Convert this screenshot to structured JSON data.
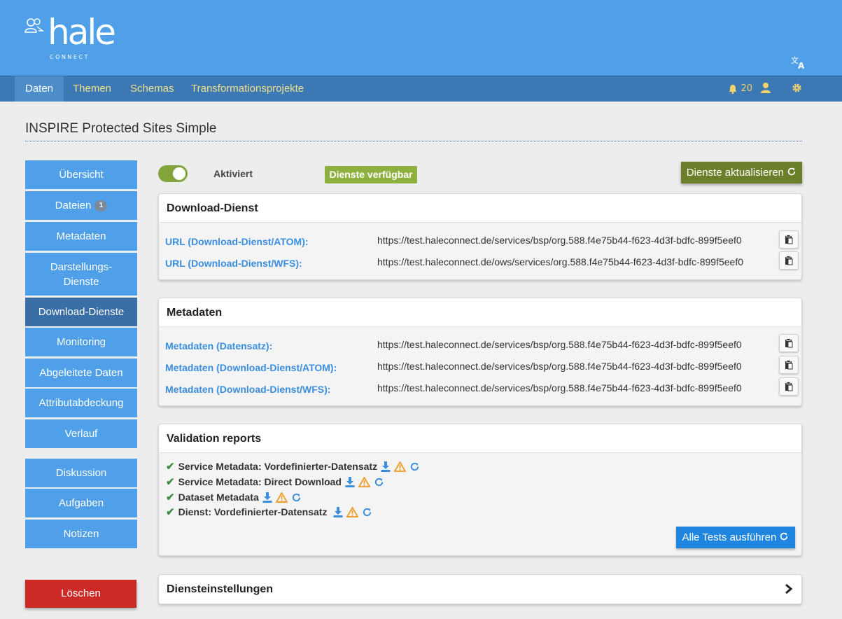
{
  "header": {
    "logo_text": "hale",
    "logo_sub": "CONNECT",
    "translate_icon": "translate-icon"
  },
  "nav": {
    "items": [
      {
        "label": "Daten",
        "active": true
      },
      {
        "label": "Themen"
      },
      {
        "label": "Schemas"
      },
      {
        "label": "Transformationsprojekte"
      }
    ],
    "notifications_count": "20",
    "icons": [
      "bell-icon",
      "user-icon",
      "gear-icon"
    ]
  },
  "page": {
    "title": "INSPIRE Protected Sites Simple"
  },
  "sidebar": {
    "items": [
      {
        "label": "Übersicht"
      },
      {
        "label": "Dateien",
        "badge": "1"
      },
      {
        "label": "Metadaten"
      },
      {
        "label": "Darstellungs-\nDienste"
      },
      {
        "label": "Download-Dienste",
        "active": true
      },
      {
        "label": "Monitoring"
      },
      {
        "label": "Abgeleitete Daten"
      },
      {
        "label": "Attributabdeckung"
      },
      {
        "label": "Verlauf"
      },
      {
        "label": "Diskussion"
      },
      {
        "label": "Aufgaben"
      },
      {
        "label": "Notizen"
      }
    ],
    "delete_label": "Löschen"
  },
  "controls": {
    "toggle_label": "Aktiviert",
    "toggle_on": true,
    "status_badge": "Dienste verfügbar",
    "refresh_label": "Dienste aktualisieren"
  },
  "download_panel": {
    "title": "Download-Dienst",
    "rows": [
      {
        "label": "URL (Download-Dienst/ATOM):",
        "url": "https://test.haleconnect.de/services/bsp/org.588.f4e75b44-f623-4d3f-bdfc-899f5eef0"
      },
      {
        "label": "URL (Download-Dienst/WFS):",
        "url": "https://test.haleconnect.de/ows/services/org.588.f4e75b44-f623-4d3f-bdfc-899f5eef0"
      }
    ]
  },
  "metadata_panel": {
    "title": "Metadaten",
    "rows": [
      {
        "label": "Metadaten (Datensatz):",
        "url": "https://test.haleconnect.de/services/bsp/org.588.f4e75b44-f623-4d3f-bdfc-899f5eef0"
      },
      {
        "label": "Metadaten (Download-Dienst/ATOM):",
        "url": "https://test.haleconnect.de/services/bsp/org.588.f4e75b44-f623-4d3f-bdfc-899f5eef0"
      },
      {
        "label": "Metadaten (Download-Dienst/WFS):",
        "url": "https://test.haleconnect.de/services/bsp/org.588.f4e75b44-f623-4d3f-bdfc-899f5eef0"
      }
    ]
  },
  "validation_panel": {
    "title": "Validation reports",
    "reports": [
      {
        "label": "Service Metadata: Vordefinierter-Datensatz"
      },
      {
        "label": "Service Metadata: Direct Download"
      },
      {
        "label": "Dataset Metadata"
      },
      {
        "label": "Dienst: Vordefinierter-Datensatz"
      }
    ],
    "run_all_label": "Alle Tests ausführen"
  },
  "settings_panel": {
    "title": "Diensteinstellungen"
  },
  "colors": {
    "header_blue": "#4fa0e8",
    "nav_blue": "#3b78b4",
    "sidebar_blue": "#4fa0e8",
    "sidebar_active": "#3a6ea6",
    "link_blue": "#3a8ee0",
    "success_green": "#3e8e3e",
    "warning_orange": "#f0a030",
    "delete_red": "#cc2a26",
    "olive_button": "#6b7f2b",
    "toggle_green": "#83a33b"
  }
}
